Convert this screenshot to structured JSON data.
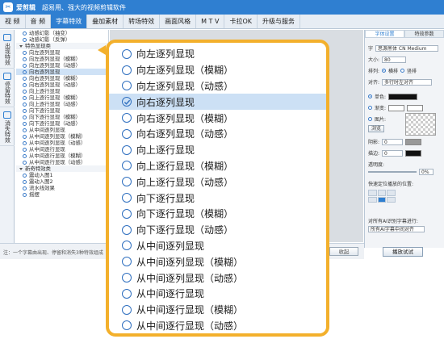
{
  "app": {
    "name": "爱剪辑",
    "slogan": "超易用、强大的视频剪辑软件"
  },
  "menu": [
    "视 频",
    "音 频",
    "字幕特效",
    "叠加素材",
    "转场特效",
    "画面风格",
    "M T V",
    "卡拉OK",
    "升级与服务"
  ],
  "vtabs": [
    "出现特效",
    "停留特效",
    "消失特效"
  ],
  "leftlist": {
    "top_items": [
      "动感幻影（抽变）",
      "动感幻影（反弹）"
    ],
    "group1": "特色显现类",
    "items": [
      "向左逐列显现",
      "向左逐列显现（模糊）",
      "向左逐列显现（动感）",
      "向右逐列显现",
      "向右逐列显现（模糊）",
      "向右逐列显现（动感）",
      "向上逐行显现",
      "向上逐行显现（模糊）",
      "向上逐行显现（动感）",
      "向下逐行显现",
      "向下逐行显现（模糊）",
      "向下逐行显现（动感）",
      "从中间逐列显现",
      "从中间逐列显现（模糊）",
      "从中间逐列显现（动感）",
      "从中间逐行显现",
      "从中间逐行显现（模糊）",
      "从中间逐行显现（动感）"
    ],
    "group2": "新奇特效类",
    "items2": [
      "震动入图1",
      "震动入图2",
      "流水线效果",
      "摇摆"
    ]
  },
  "right_panel": {
    "tabs": [
      "字体设置",
      "特效参数"
    ],
    "font_label": "字",
    "font_name": "思源黑体 CN Medium",
    "size_label": "大小:",
    "size_value": "80",
    "layout_label": "排列:",
    "horizontal": "横排",
    "vertical": "竖排",
    "align_label": "对齐:",
    "align_value": "多行时左对齐",
    "solid_color": "单色:",
    "gradient": "渐变:",
    "texture": "图片:",
    "browse": "浏览",
    "shadow_label": "阴影:",
    "shadow_value": "0",
    "stroke_label": "描边:",
    "stroke_value": "0",
    "opacity_label": "透明度:",
    "opacity_value": "0%",
    "position_label": "快速定位播放的位置:",
    "ai_label": "对所有AI识别字幕进行:",
    "ai_value": "所有AI字幕中间对齐"
  },
  "bottom": {
    "hint": "注：一个字幕由出现、停留和消失3种特效组成",
    "collapse": "收起",
    "play": "播放试试"
  },
  "zoom_list": {
    "selected_index": 3,
    "items": [
      "向左逐列显现",
      "向左逐列显现（模糊）",
      "向左逐列显现（动感）",
      "向右逐列显现",
      "向右逐列显现（模糊）",
      "向右逐列显现（动感）",
      "向上逐行显现",
      "向上逐行显现（模糊）",
      "向上逐行显现（动感）",
      "向下逐行显现",
      "向下逐行显现（模糊）",
      "向下逐行显现（动感）",
      "从中间逐列显现",
      "从中间逐列显现（模糊）",
      "从中间逐列显现（动感）",
      "从中间逐行显现",
      "从中间逐行显现（模糊）",
      "从中间逐行显现（动感）"
    ]
  },
  "colors": {
    "accent": "#2f7fd1",
    "callout_border": "#f3b02c",
    "selection": "#cce0f5"
  }
}
